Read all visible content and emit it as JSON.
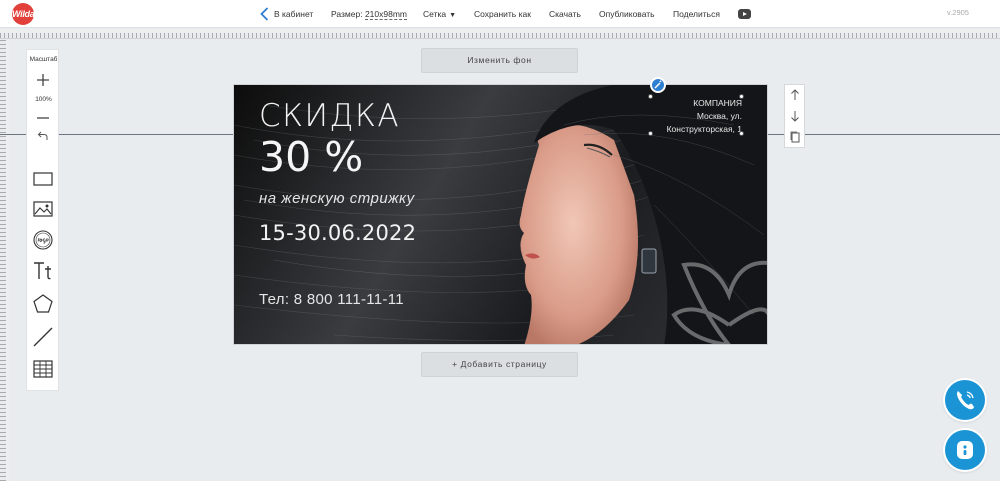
{
  "app": {
    "logo_text": "Wilda",
    "version": "v.2905"
  },
  "topbar": {
    "back_label": "В кабинет",
    "size_label": "Размер:",
    "size_value": "210x98mm",
    "grid_label": "Сетка",
    "grid_caret": "▼",
    "save_as_label": "Сохранить как",
    "download_label": "Скачать",
    "publish_label": "Опубликовать",
    "share_label": "Поделиться"
  },
  "toolpanel": {
    "zoom_title": "Масштаб",
    "zoom_value": "100%",
    "tools": [
      "rectangle",
      "image",
      "logo",
      "text",
      "shape",
      "line",
      "table"
    ]
  },
  "canvas_actions": {
    "change_bg_label": "Изменить фон",
    "add_page_label": "+ Добавить страницу"
  },
  "banner": {
    "headline": "СКИДКА",
    "percent": "30 %",
    "subline": "на женскую стрижку",
    "dates": "15-30.06.2022",
    "phone": "Тел: 8 800 111-11-11",
    "company_lines": [
      "КОМПАНИЯ",
      "Москва, ул.",
      "Конструкторская, 1"
    ]
  },
  "icons": {
    "logo": "wilda-logo-icon",
    "back": "chevron-left-icon",
    "youtube": "youtube-icon",
    "rotate": "magic-wand-icon",
    "move_up": "arrow-up-icon",
    "move_down": "arrow-down-icon",
    "copy": "copy-icon",
    "call": "phone-icon",
    "chat": "chat-icon"
  },
  "colors": {
    "accent": "#1b94d5",
    "logo_red": "#e2403a",
    "background": "#e9ecef",
    "handle_blue": "#2f7fd1"
  }
}
